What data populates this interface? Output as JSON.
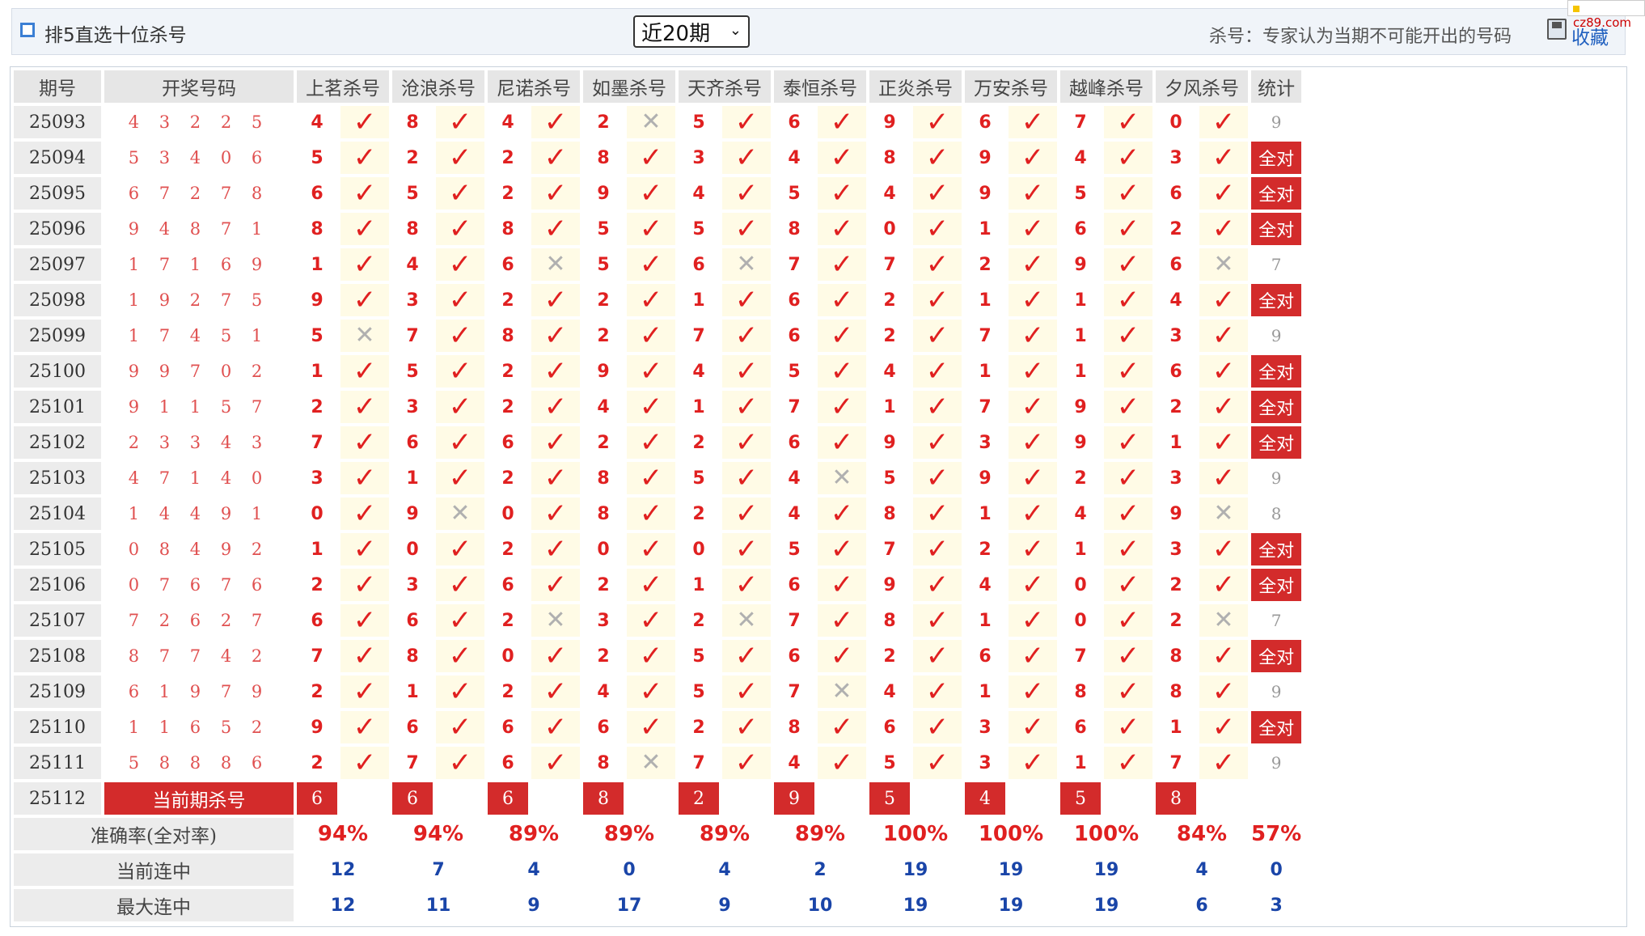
{
  "header": {
    "title": "排5直选十位杀号",
    "period_selected": "近20期",
    "note": "杀号：专家认为当期不可能开出的号码",
    "favorite": "收藏",
    "brand": "cz89.com"
  },
  "columns": {
    "issue": "期号",
    "draw": "开奖号码",
    "experts": [
      "上茗杀号",
      "沧浪杀号",
      "尼诺杀号",
      "如墨杀号",
      "天齐杀号",
      "泰恒杀号",
      "正炎杀号",
      "万安杀号",
      "越峰杀号",
      "夕风杀号"
    ],
    "stats": "统计"
  },
  "rows": [
    {
      "issue": "25093",
      "draw": "4 3 2 2 5",
      "kills": [
        "4",
        "8",
        "4",
        "2",
        "5",
        "6",
        "9",
        "6",
        "7",
        "0"
      ],
      "hits": [
        1,
        1,
        1,
        0,
        1,
        1,
        1,
        1,
        1,
        1
      ],
      "stat": "9"
    },
    {
      "issue": "25094",
      "draw": "5 3 4 0 6",
      "kills": [
        "5",
        "2",
        "2",
        "8",
        "3",
        "4",
        "8",
        "9",
        "4",
        "3"
      ],
      "hits": [
        1,
        1,
        1,
        1,
        1,
        1,
        1,
        1,
        1,
        1
      ],
      "stat": "全对"
    },
    {
      "issue": "25095",
      "draw": "6 7 2 7 8",
      "kills": [
        "6",
        "5",
        "2",
        "9",
        "4",
        "5",
        "4",
        "9",
        "5",
        "6"
      ],
      "hits": [
        1,
        1,
        1,
        1,
        1,
        1,
        1,
        1,
        1,
        1
      ],
      "stat": "全对"
    },
    {
      "issue": "25096",
      "draw": "9 4 8 7 1",
      "kills": [
        "8",
        "8",
        "8",
        "5",
        "5",
        "8",
        "0",
        "1",
        "6",
        "2"
      ],
      "hits": [
        1,
        1,
        1,
        1,
        1,
        1,
        1,
        1,
        1,
        1
      ],
      "stat": "全对"
    },
    {
      "issue": "25097",
      "draw": "1 7 1 6 9",
      "kills": [
        "1",
        "4",
        "6",
        "5",
        "6",
        "7",
        "7",
        "2",
        "9",
        "6"
      ],
      "hits": [
        1,
        1,
        0,
        1,
        0,
        1,
        1,
        1,
        1,
        0
      ],
      "stat": "7"
    },
    {
      "issue": "25098",
      "draw": "1 9 2 7 5",
      "kills": [
        "9",
        "3",
        "2",
        "2",
        "1",
        "6",
        "2",
        "1",
        "1",
        "4"
      ],
      "hits": [
        1,
        1,
        1,
        1,
        1,
        1,
        1,
        1,
        1,
        1
      ],
      "stat": "全对"
    },
    {
      "issue": "25099",
      "draw": "1 7 4 5 1",
      "kills": [
        "5",
        "7",
        "8",
        "2",
        "7",
        "6",
        "2",
        "7",
        "1",
        "3"
      ],
      "hits": [
        0,
        1,
        1,
        1,
        1,
        1,
        1,
        1,
        1,
        1
      ],
      "stat": "9"
    },
    {
      "issue": "25100",
      "draw": "9 9 7 0 2",
      "kills": [
        "1",
        "5",
        "2",
        "9",
        "4",
        "5",
        "4",
        "1",
        "1",
        "6"
      ],
      "hits": [
        1,
        1,
        1,
        1,
        1,
        1,
        1,
        1,
        1,
        1
      ],
      "stat": "全对"
    },
    {
      "issue": "25101",
      "draw": "9 1 1 5 7",
      "kills": [
        "2",
        "3",
        "2",
        "4",
        "1",
        "7",
        "1",
        "7",
        "9",
        "2"
      ],
      "hits": [
        1,
        1,
        1,
        1,
        1,
        1,
        1,
        1,
        1,
        1
      ],
      "stat": "全对"
    },
    {
      "issue": "25102",
      "draw": "2 3 3 4 3",
      "kills": [
        "7",
        "6",
        "6",
        "2",
        "2",
        "6",
        "9",
        "3",
        "9",
        "1"
      ],
      "hits": [
        1,
        1,
        1,
        1,
        1,
        1,
        1,
        1,
        1,
        1
      ],
      "stat": "全对"
    },
    {
      "issue": "25103",
      "draw": "4 7 1 4 0",
      "kills": [
        "3",
        "1",
        "2",
        "8",
        "5",
        "4",
        "5",
        "9",
        "2",
        "3"
      ],
      "hits": [
        1,
        1,
        1,
        1,
        1,
        0,
        1,
        1,
        1,
        1
      ],
      "stat": "9"
    },
    {
      "issue": "25104",
      "draw": "1 4 4 9 1",
      "kills": [
        "0",
        "9",
        "0",
        "8",
        "2",
        "4",
        "8",
        "1",
        "4",
        "9"
      ],
      "hits": [
        1,
        0,
        1,
        1,
        1,
        1,
        1,
        1,
        1,
        0
      ],
      "stat": "8"
    },
    {
      "issue": "25105",
      "draw": "0 8 4 9 2",
      "kills": [
        "1",
        "0",
        "2",
        "0",
        "0",
        "5",
        "7",
        "2",
        "1",
        "3"
      ],
      "hits": [
        1,
        1,
        1,
        1,
        1,
        1,
        1,
        1,
        1,
        1
      ],
      "stat": "全对"
    },
    {
      "issue": "25106",
      "draw": "0 7 6 7 6",
      "kills": [
        "2",
        "3",
        "6",
        "2",
        "1",
        "6",
        "9",
        "4",
        "0",
        "2"
      ],
      "hits": [
        1,
        1,
        1,
        1,
        1,
        1,
        1,
        1,
        1,
        1
      ],
      "stat": "全对"
    },
    {
      "issue": "25107",
      "draw": "7 2 6 2 7",
      "kills": [
        "6",
        "6",
        "2",
        "3",
        "2",
        "7",
        "8",
        "1",
        "0",
        "2"
      ],
      "hits": [
        1,
        1,
        0,
        1,
        0,
        1,
        1,
        1,
        1,
        0
      ],
      "stat": "7"
    },
    {
      "issue": "25108",
      "draw": "8 7 7 4 2",
      "kills": [
        "7",
        "8",
        "0",
        "2",
        "5",
        "6",
        "2",
        "6",
        "7",
        "8"
      ],
      "hits": [
        1,
        1,
        1,
        1,
        1,
        1,
        1,
        1,
        1,
        1
      ],
      "stat": "全对"
    },
    {
      "issue": "25109",
      "draw": "6 1 9 7 9",
      "kills": [
        "2",
        "1",
        "2",
        "4",
        "5",
        "7",
        "4",
        "1",
        "8",
        "8"
      ],
      "hits": [
        1,
        1,
        1,
        1,
        1,
        0,
        1,
        1,
        1,
        1
      ],
      "stat": "9"
    },
    {
      "issue": "25110",
      "draw": "1 1 6 5 2",
      "kills": [
        "9",
        "6",
        "6",
        "6",
        "2",
        "8",
        "6",
        "3",
        "6",
        "1"
      ],
      "hits": [
        1,
        1,
        1,
        1,
        1,
        1,
        1,
        1,
        1,
        1
      ],
      "stat": "全对"
    },
    {
      "issue": "25111",
      "draw": "5 8 8 8 6",
      "kills": [
        "2",
        "7",
        "6",
        "8",
        "7",
        "4",
        "5",
        "3",
        "1",
        "7"
      ],
      "hits": [
        1,
        1,
        1,
        0,
        1,
        1,
        1,
        1,
        1,
        1
      ],
      "stat": "9"
    }
  ],
  "current": {
    "issue": "25112",
    "label": "当前期杀号",
    "kills": [
      "6",
      "6",
      "6",
      "8",
      "2",
      "9",
      "5",
      "4",
      "5",
      "8"
    ]
  },
  "footer": {
    "accuracy_label": "准确率(全对率)",
    "accuracy": [
      "94%",
      "94%",
      "89%",
      "89%",
      "89%",
      "89%",
      "100%",
      "100%",
      "100%",
      "84%"
    ],
    "accuracy_total": "57%",
    "streak_label": "当前连中",
    "streak": [
      "12",
      "7",
      "4",
      "0",
      "4",
      "2",
      "19",
      "19",
      "19",
      "4"
    ],
    "streak_total": "0",
    "max_label": "最大连中",
    "max": [
      "12",
      "11",
      "9",
      "17",
      "9",
      "10",
      "19",
      "19",
      "19",
      "6"
    ],
    "max_total": "3"
  },
  "marks": {
    "hit": "✓",
    "miss": "✕"
  },
  "colors": {
    "accent_red": "#d32b2b",
    "kill_red": "#e02020",
    "blue": "#1a45a8",
    "mark_bg": "#fffbe6"
  }
}
